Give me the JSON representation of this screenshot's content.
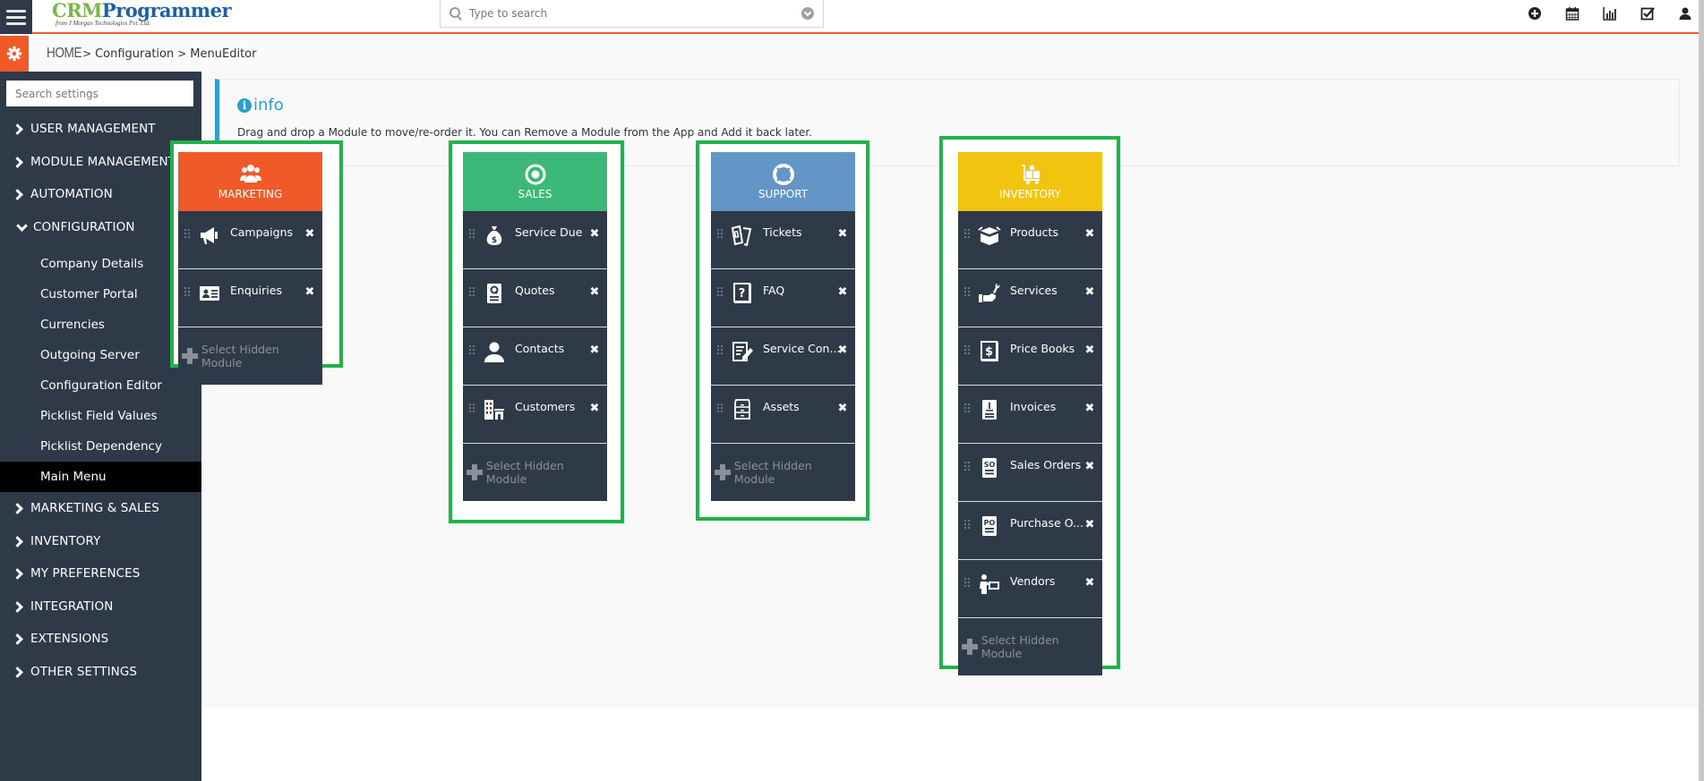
{
  "header": {
    "logo_primary": "CRM",
    "logo_secondary": "Programmer",
    "logo_tagline": "from J Morgan Technologies Pvt. Ltd.",
    "search_placeholder": "Type to search",
    "icons": [
      "add-circle-icon",
      "calendar-icon",
      "bar-chart-icon",
      "checkbox-icon",
      "user-icon"
    ]
  },
  "breadcrumb": {
    "items": [
      "HOME",
      "Configuration",
      "MenuEditor"
    ],
    "separator": ">"
  },
  "sidebar": {
    "search_placeholder": "Search settings",
    "sections": [
      {
        "label": "USER MANAGEMENT",
        "open": false
      },
      {
        "label": "MODULE MANAGEMENT",
        "open": false
      },
      {
        "label": "AUTOMATION",
        "open": false
      },
      {
        "label": "CONFIGURATION",
        "open": true,
        "items": [
          "Company Details",
          "Customer Portal",
          "Currencies",
          "Outgoing Server",
          "Configuration Editor",
          "Picklist Field Values",
          "Picklist Dependency",
          "Main Menu"
        ],
        "active_item": "Main Menu"
      },
      {
        "label": "MARKETING & SALES",
        "open": false
      },
      {
        "label": "INVENTORY",
        "open": false
      },
      {
        "label": "MY PREFERENCES",
        "open": false
      },
      {
        "label": "INTEGRATION",
        "open": false
      },
      {
        "label": "EXTENSIONS",
        "open": false
      },
      {
        "label": "OTHER SETTINGS",
        "open": false
      }
    ]
  },
  "info": {
    "title": "info",
    "text": "Drag and drop a Module to move/re-order it. You can Remove a Module from the App and Add it back later."
  },
  "hidden_module_label": "Select Hidden Module",
  "remove_glyph": "✖",
  "colors": {
    "accent": "#f05a28",
    "sidebar_bg": "#2e3a48",
    "info_blue": "#2a9fd0",
    "highlight_green": "#22b24c",
    "marketing": "#f05a28",
    "sales": "#3cb878",
    "support": "#6396c6",
    "inventory": "#f1c40f"
  },
  "apps": [
    {
      "name": "MARKETING",
      "icon": "group-icon",
      "color": "#f05a28",
      "modules": [
        {
          "label": "Campaigns",
          "icon": "megaphone-icon"
        },
        {
          "label": "Enquiries",
          "icon": "id-card-icon"
        }
      ]
    },
    {
      "name": "SALES",
      "icon": "target-icon",
      "color": "#3cb878",
      "modules": [
        {
          "label": "Service Due",
          "icon": "money-bag-icon"
        },
        {
          "label": "Quotes",
          "icon": "quote-document-icon"
        },
        {
          "label": "Contacts",
          "icon": "person-icon"
        },
        {
          "label": "Customers",
          "icon": "building-icon"
        }
      ]
    },
    {
      "name": "SUPPORT",
      "icon": "lifebuoy-icon",
      "color": "#6396c6",
      "modules": [
        {
          "label": "Tickets",
          "icon": "ticket-icon"
        },
        {
          "label": "FAQ",
          "icon": "question-book-icon"
        },
        {
          "label": "Service Con...",
          "icon": "contract-edit-icon"
        },
        {
          "label": "Assets",
          "icon": "cabinet-icon"
        }
      ]
    },
    {
      "name": "INVENTORY",
      "icon": "trolley-icon",
      "color": "#f1c40f",
      "modules": [
        {
          "label": "Products",
          "icon": "box-icon"
        },
        {
          "label": "Services",
          "icon": "wrench-hand-icon"
        },
        {
          "label": "Price Books",
          "icon": "price-book-icon"
        },
        {
          "label": "Invoices",
          "icon": "invoice-icon"
        },
        {
          "label": "Sales Orders",
          "icon": "sales-order-icon"
        },
        {
          "label": "Purchase O...",
          "icon": "purchase-order-icon"
        },
        {
          "label": "Vendors",
          "icon": "vendor-icon"
        }
      ]
    }
  ]
}
